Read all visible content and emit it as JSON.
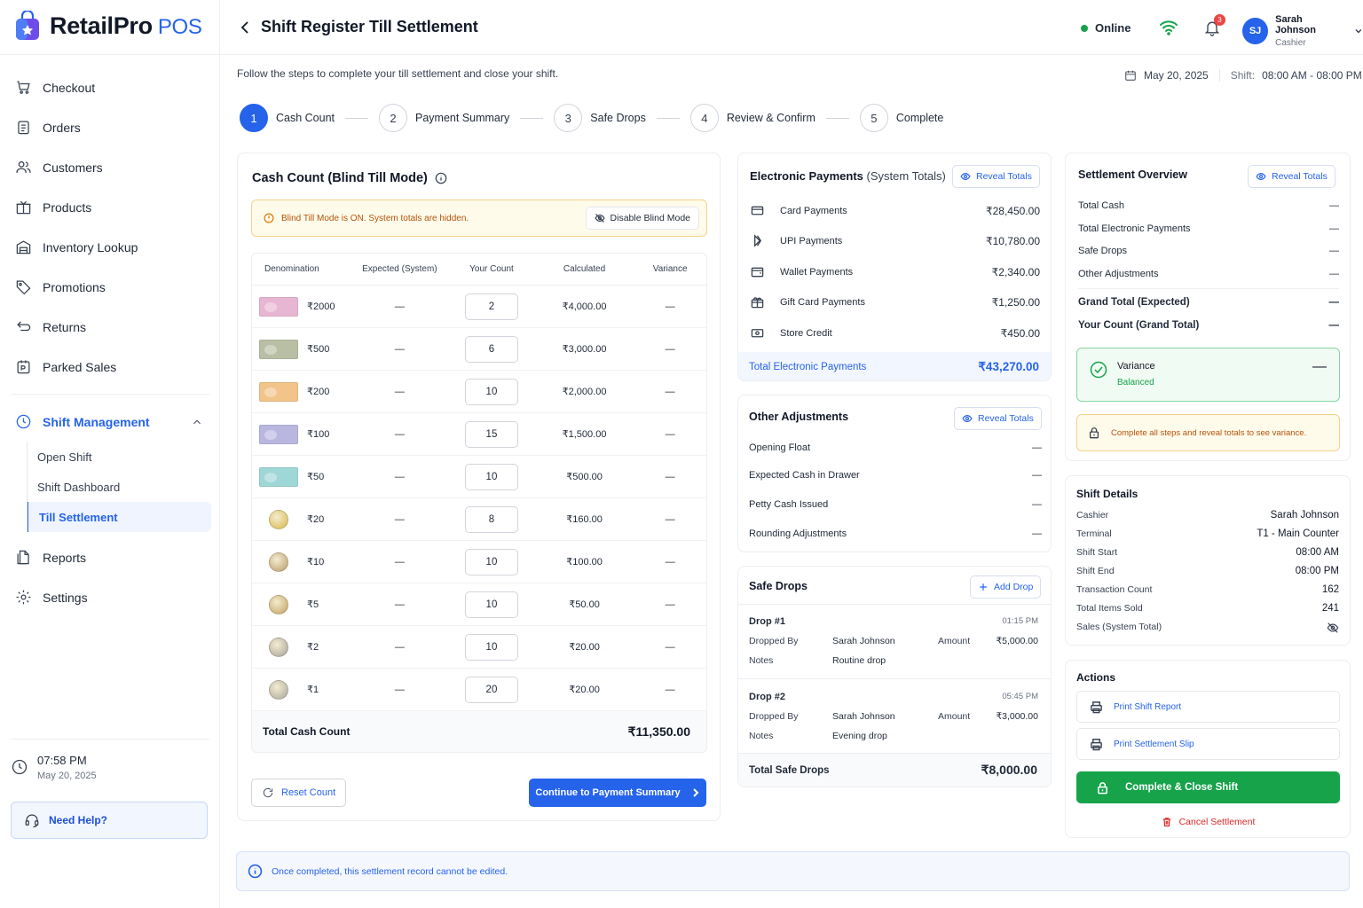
{
  "app": {
    "name": "RetailPro",
    "suffix": "POS"
  },
  "sidebar": {
    "items": [
      {
        "label": "Checkout",
        "icon": "cart-icon"
      },
      {
        "label": "Orders",
        "icon": "clipboard-icon"
      },
      {
        "label": "Customers",
        "icon": "users-icon"
      },
      {
        "label": "Products",
        "icon": "box-icon"
      },
      {
        "label": "Inventory Lookup",
        "icon": "warehouse-icon"
      },
      {
        "label": "Promotions",
        "icon": "tag-icon"
      },
      {
        "label": "Returns",
        "icon": "return-icon"
      },
      {
        "label": "Parked Sales",
        "icon": "parked-icon"
      }
    ],
    "group": {
      "label": "Shift Management",
      "sub": [
        "Open Shift",
        "Shift Dashboard",
        "Till Settlement"
      ]
    },
    "bottom_items": [
      {
        "label": "Reports",
        "icon": "reports-icon"
      },
      {
        "label": "Settings",
        "icon": "settings-icon"
      }
    ],
    "clock": {
      "time": "07:58 PM",
      "date": "May 20, 2025"
    },
    "help": "Need Help?"
  },
  "header": {
    "title": "Shift Register Till Settlement",
    "status": "Online",
    "notifications": "3",
    "user": {
      "initials": "SJ",
      "name": "Sarah Johnson",
      "role": "Cashier"
    }
  },
  "intro": "Follow the steps to complete your till settlement and close your shift.",
  "date": "May 20, 2025",
  "shift_label": "Shift:",
  "shift_time": "08:00 AM - 08:00 PM",
  "steps": [
    {
      "num": "1",
      "label": "Cash Count"
    },
    {
      "num": "2",
      "label": "Payment Summary"
    },
    {
      "num": "3",
      "label": "Safe Drops"
    },
    {
      "num": "4",
      "label": "Review & Confirm"
    },
    {
      "num": "5",
      "label": "Complete"
    }
  ],
  "cash_count": {
    "title": "Cash Count (Blind Till Mode)",
    "blind_msg": "Blind Till Mode is ON. System totals are hidden.",
    "disable_btn": "Disable Blind Mode",
    "headers": [
      "Denomination",
      "Expected (System)",
      "Your Count",
      "Calculated",
      "Variance"
    ],
    "rows": [
      {
        "denom": "₹2000",
        "expected": "—",
        "count": "2",
        "calc": "₹4,000.00",
        "variance": "—",
        "kind": "note",
        "color": "#e7b6d2"
      },
      {
        "denom": "₹500",
        "expected": "—",
        "count": "6",
        "calc": "₹3,000.00",
        "variance": "—",
        "kind": "note",
        "color": "#b9bfa4"
      },
      {
        "denom": "₹200",
        "expected": "—",
        "count": "10",
        "calc": "₹2,000.00",
        "variance": "—",
        "kind": "note",
        "color": "#f2c48a"
      },
      {
        "denom": "₹100",
        "expected": "—",
        "count": "15",
        "calc": "₹1,500.00",
        "variance": "—",
        "kind": "note",
        "color": "#b9b6e0"
      },
      {
        "denom": "₹50",
        "expected": "—",
        "count": "10",
        "calc": "₹500.00",
        "variance": "—",
        "kind": "note",
        "color": "#9fd6d6"
      },
      {
        "denom": "₹20",
        "expected": "—",
        "count": "8",
        "calc": "₹160.00",
        "variance": "—",
        "kind": "coin",
        "color": "#d8b84a"
      },
      {
        "denom": "₹10",
        "expected": "—",
        "count": "10",
        "calc": "₹100.00",
        "variance": "—",
        "kind": "coin",
        "color": "#b99b6a"
      },
      {
        "denom": "₹5",
        "expected": "—",
        "count": "10",
        "calc": "₹50.00",
        "variance": "—",
        "kind": "coin",
        "color": "#c2a15f"
      },
      {
        "denom": "₹2",
        "expected": "—",
        "count": "10",
        "calc": "₹20.00",
        "variance": "—",
        "kind": "coin",
        "color": "#a9a39a"
      },
      {
        "denom": "₹1",
        "expected": "—",
        "count": "20",
        "calc": "₹20.00",
        "variance": "—",
        "kind": "coin",
        "color": "#aaa69e"
      }
    ],
    "total_label": "Total Cash Count",
    "total": "₹11,350.00",
    "reset_btn": "Reset Count",
    "continue_btn": "Continue to Payment Summary"
  },
  "electronic": {
    "title": "Electronic Payments",
    "subtitle": "(System Totals)",
    "reveal": "Reveal Totals",
    "rows": [
      {
        "label": "Card Payments",
        "value": "₹28,450.00",
        "icon": "card-icon"
      },
      {
        "label": "UPI Payments",
        "value": "₹10,780.00",
        "icon": "upi-icon"
      },
      {
        "label": "Wallet Payments",
        "value": "₹2,340.00",
        "icon": "wallet-icon"
      },
      {
        "label": "Gift Card Payments",
        "value": "₹1,250.00",
        "icon": "gift-icon"
      },
      {
        "label": "Store Credit",
        "value": "₹450.00",
        "icon": "store-credit-icon"
      }
    ],
    "total_label": "Total Electronic Payments",
    "total": "₹43,270.00"
  },
  "adjustments": {
    "title": "Other Adjustments",
    "reveal": "Reveal Totals",
    "rows": [
      {
        "label": "Opening Float",
        "value": "—"
      },
      {
        "label": "Expected Cash in Drawer",
        "value": "—"
      },
      {
        "label": "Petty Cash Issued",
        "value": "—"
      },
      {
        "label": "Rounding Adjustments",
        "value": "—"
      }
    ]
  },
  "safe_drops": {
    "title": "Safe Drops",
    "add": "Add Drop",
    "dropped_by_label": "Dropped By",
    "amount_label": "Amount",
    "notes_label": "Notes",
    "drops": [
      {
        "name": "Drop #1",
        "time": "01:15 PM",
        "by": "Sarah Johnson",
        "amount": "₹5,000.00",
        "notes": "Routine drop"
      },
      {
        "name": "Drop #2",
        "time": "05:45 PM",
        "by": "Sarah Johnson",
        "amount": "₹3,000.00",
        "notes": "Evening drop"
      }
    ],
    "total_label": "Total Safe Drops",
    "total": "₹8,000.00"
  },
  "overview": {
    "title": "Settlement Overview",
    "reveal": "Reveal Totals",
    "rows": [
      {
        "label": "Total Cash",
        "value": "—"
      },
      {
        "label": "Total Electronic Payments",
        "value": "—"
      },
      {
        "label": "Safe Drops",
        "value": "—"
      },
      {
        "label": "Other Adjustments",
        "value": "—"
      }
    ],
    "bold_rows": [
      {
        "label": "Grand Total (Expected)",
        "value": "—"
      },
      {
        "label": "Your Count (Grand Total)",
        "value": "—"
      }
    ],
    "variance": {
      "label": "Variance",
      "status": "Balanced",
      "value": "—"
    },
    "warning": "Complete all steps and reveal totals to see variance."
  },
  "shift_details": {
    "title": "Shift Details",
    "rows": [
      {
        "label": "Cashier",
        "value": "Sarah Johnson"
      },
      {
        "label": "Terminal",
        "value": "T1 - Main Counter"
      },
      {
        "label": "Shift Start",
        "value": "08:00 AM"
      },
      {
        "label": "Shift End",
        "value": "08:00 PM"
      },
      {
        "label": "Transaction Count",
        "value": "162"
      },
      {
        "label": "Total Items Sold",
        "value": "241"
      },
      {
        "label": "Sales (System Total)",
        "value": ""
      }
    ]
  },
  "actions": {
    "title": "Actions",
    "print_report": "Print Shift Report",
    "print_slip": "Print Settlement Slip",
    "complete": "Complete & Close Shift",
    "cancel": "Cancel Settlement"
  },
  "footer_note": "Once completed, this settlement record cannot be edited.",
  "colors": {
    "accent": "#2563eb",
    "success": "#16a34a",
    "warning": "#d97706",
    "danger": "#dc2626"
  }
}
